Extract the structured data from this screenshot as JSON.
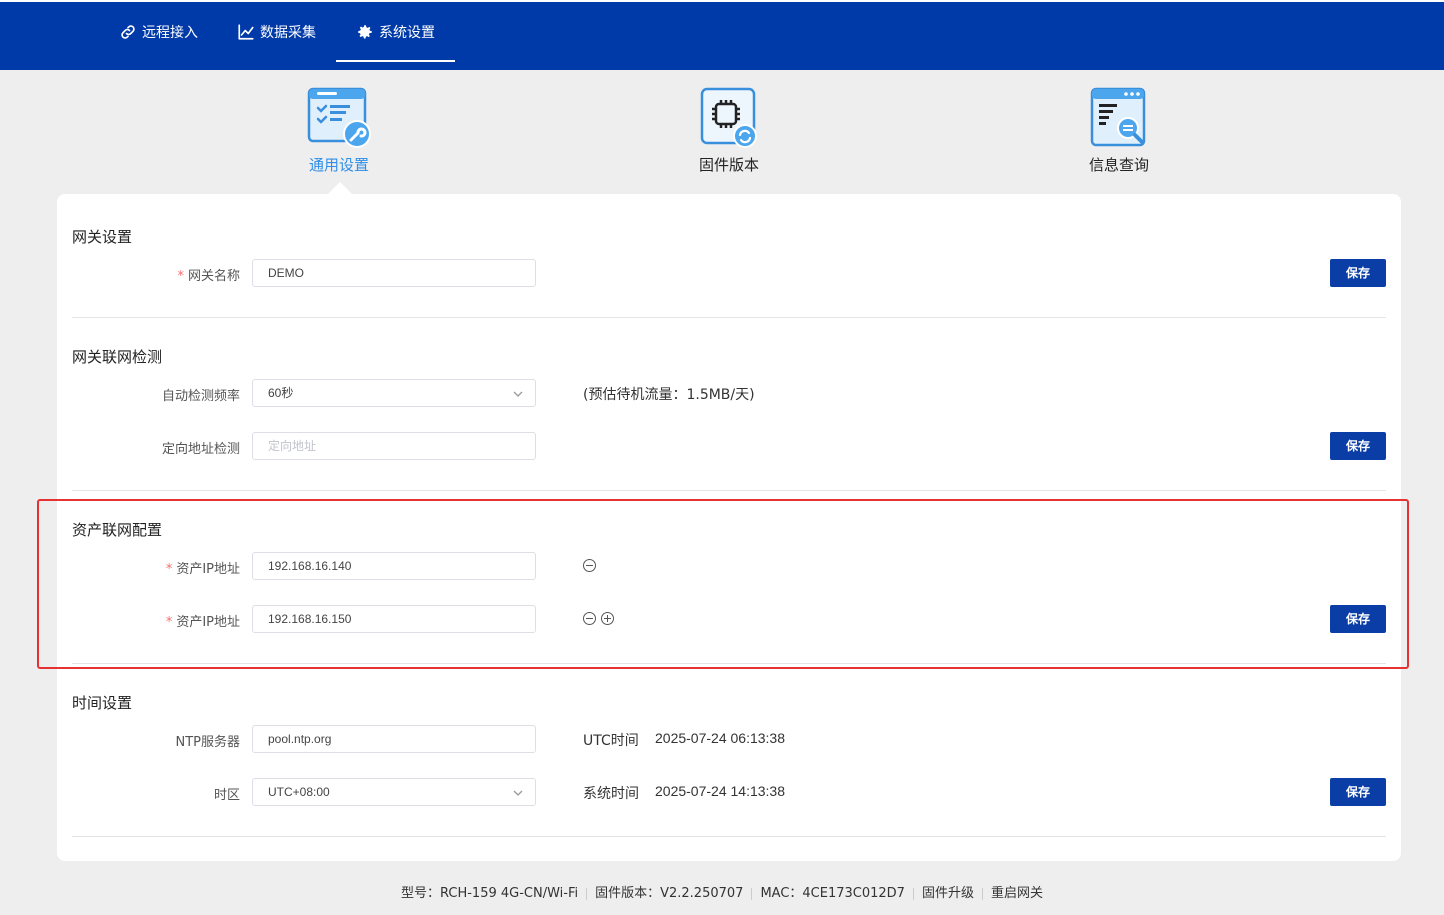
{
  "nav": {
    "items": [
      {
        "label": "远程接入",
        "icon": "link-icon"
      },
      {
        "label": "数据采集",
        "icon": "chart-icon"
      },
      {
        "label": "系统设置",
        "icon": "gear-icon"
      }
    ],
    "active_index": 2
  },
  "tabs": [
    {
      "label": "通用设置",
      "icon": "general-settings-icon",
      "active": true
    },
    {
      "label": "固件版本",
      "icon": "firmware-chip-icon",
      "active": false
    },
    {
      "label": "信息查询",
      "icon": "info-query-icon",
      "active": false
    }
  ],
  "gateway": {
    "title": "网关设置",
    "name_label": "网关名称",
    "name_value": "DEMO",
    "save_label": "保存"
  },
  "netcheck": {
    "title": "网关联网检测",
    "freq_label": "自动检测频率",
    "freq_value": "60秒",
    "traffic_note": "(预估待机流量：1.5MB/天)",
    "target_label": "定向地址检测",
    "target_placeholder": "定向地址",
    "save_label": "保存"
  },
  "asset": {
    "title": "资产联网配置",
    "ip_label_1": "资产IP地址",
    "ip_value_1": "192.168.16.140",
    "ip_label_2": "资产IP地址",
    "ip_value_2": "192.168.16.150",
    "save_label": "保存"
  },
  "time": {
    "title": "时间设置",
    "ntp_label": "NTP服务器",
    "ntp_value": "pool.ntp.org",
    "tz_label": "时区",
    "tz_value": "UTC+08:00",
    "utc_label": "UTC时间",
    "utc_value": "2025-07-24 06:13:38",
    "sys_label": "系统时间",
    "sys_value": "2025-07-24 14:13:38",
    "save_label": "保存"
  },
  "footer": {
    "model": "型号：RCH-159  4G-CN/Wi-Fi",
    "firmware": "固件版本：V2.2.250707",
    "mac": "MAC：4CE173C012D7",
    "upgrade": "固件升级",
    "reboot": "重启网关"
  },
  "colors": {
    "nav_bg": "#003aa8",
    "primary_button": "#0a3ea6",
    "active_tab": "#2f8ee8",
    "highlight_border": "#e63232",
    "required_star": "#f56c6c"
  }
}
